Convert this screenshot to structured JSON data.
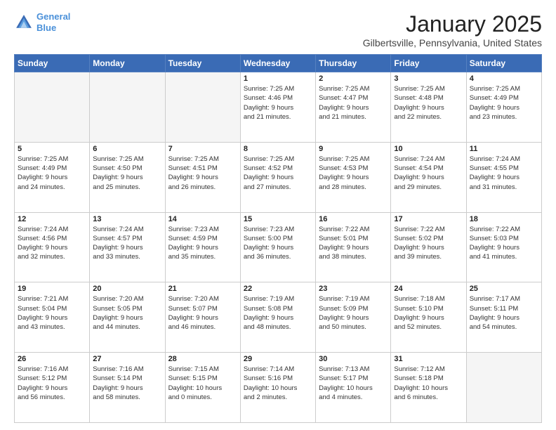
{
  "header": {
    "logo_line1": "General",
    "logo_line2": "Blue",
    "month": "January 2025",
    "location": "Gilbertsville, Pennsylvania, United States"
  },
  "weekdays": [
    "Sunday",
    "Monday",
    "Tuesday",
    "Wednesday",
    "Thursday",
    "Friday",
    "Saturday"
  ],
  "weeks": [
    [
      {
        "day": "",
        "info": ""
      },
      {
        "day": "",
        "info": ""
      },
      {
        "day": "",
        "info": ""
      },
      {
        "day": "1",
        "info": "Sunrise: 7:25 AM\nSunset: 4:46 PM\nDaylight: 9 hours\nand 21 minutes."
      },
      {
        "day": "2",
        "info": "Sunrise: 7:25 AM\nSunset: 4:47 PM\nDaylight: 9 hours\nand 21 minutes."
      },
      {
        "day": "3",
        "info": "Sunrise: 7:25 AM\nSunset: 4:48 PM\nDaylight: 9 hours\nand 22 minutes."
      },
      {
        "day": "4",
        "info": "Sunrise: 7:25 AM\nSunset: 4:49 PM\nDaylight: 9 hours\nand 23 minutes."
      }
    ],
    [
      {
        "day": "5",
        "info": "Sunrise: 7:25 AM\nSunset: 4:49 PM\nDaylight: 9 hours\nand 24 minutes."
      },
      {
        "day": "6",
        "info": "Sunrise: 7:25 AM\nSunset: 4:50 PM\nDaylight: 9 hours\nand 25 minutes."
      },
      {
        "day": "7",
        "info": "Sunrise: 7:25 AM\nSunset: 4:51 PM\nDaylight: 9 hours\nand 26 minutes."
      },
      {
        "day": "8",
        "info": "Sunrise: 7:25 AM\nSunset: 4:52 PM\nDaylight: 9 hours\nand 27 minutes."
      },
      {
        "day": "9",
        "info": "Sunrise: 7:25 AM\nSunset: 4:53 PM\nDaylight: 9 hours\nand 28 minutes."
      },
      {
        "day": "10",
        "info": "Sunrise: 7:24 AM\nSunset: 4:54 PM\nDaylight: 9 hours\nand 29 minutes."
      },
      {
        "day": "11",
        "info": "Sunrise: 7:24 AM\nSunset: 4:55 PM\nDaylight: 9 hours\nand 31 minutes."
      }
    ],
    [
      {
        "day": "12",
        "info": "Sunrise: 7:24 AM\nSunset: 4:56 PM\nDaylight: 9 hours\nand 32 minutes."
      },
      {
        "day": "13",
        "info": "Sunrise: 7:24 AM\nSunset: 4:57 PM\nDaylight: 9 hours\nand 33 minutes."
      },
      {
        "day": "14",
        "info": "Sunrise: 7:23 AM\nSunset: 4:59 PM\nDaylight: 9 hours\nand 35 minutes."
      },
      {
        "day": "15",
        "info": "Sunrise: 7:23 AM\nSunset: 5:00 PM\nDaylight: 9 hours\nand 36 minutes."
      },
      {
        "day": "16",
        "info": "Sunrise: 7:22 AM\nSunset: 5:01 PM\nDaylight: 9 hours\nand 38 minutes."
      },
      {
        "day": "17",
        "info": "Sunrise: 7:22 AM\nSunset: 5:02 PM\nDaylight: 9 hours\nand 39 minutes."
      },
      {
        "day": "18",
        "info": "Sunrise: 7:22 AM\nSunset: 5:03 PM\nDaylight: 9 hours\nand 41 minutes."
      }
    ],
    [
      {
        "day": "19",
        "info": "Sunrise: 7:21 AM\nSunset: 5:04 PM\nDaylight: 9 hours\nand 43 minutes."
      },
      {
        "day": "20",
        "info": "Sunrise: 7:20 AM\nSunset: 5:05 PM\nDaylight: 9 hours\nand 44 minutes."
      },
      {
        "day": "21",
        "info": "Sunrise: 7:20 AM\nSunset: 5:07 PM\nDaylight: 9 hours\nand 46 minutes."
      },
      {
        "day": "22",
        "info": "Sunrise: 7:19 AM\nSunset: 5:08 PM\nDaylight: 9 hours\nand 48 minutes."
      },
      {
        "day": "23",
        "info": "Sunrise: 7:19 AM\nSunset: 5:09 PM\nDaylight: 9 hours\nand 50 minutes."
      },
      {
        "day": "24",
        "info": "Sunrise: 7:18 AM\nSunset: 5:10 PM\nDaylight: 9 hours\nand 52 minutes."
      },
      {
        "day": "25",
        "info": "Sunrise: 7:17 AM\nSunset: 5:11 PM\nDaylight: 9 hours\nand 54 minutes."
      }
    ],
    [
      {
        "day": "26",
        "info": "Sunrise: 7:16 AM\nSunset: 5:12 PM\nDaylight: 9 hours\nand 56 minutes."
      },
      {
        "day": "27",
        "info": "Sunrise: 7:16 AM\nSunset: 5:14 PM\nDaylight: 9 hours\nand 58 minutes."
      },
      {
        "day": "28",
        "info": "Sunrise: 7:15 AM\nSunset: 5:15 PM\nDaylight: 10 hours\nand 0 minutes."
      },
      {
        "day": "29",
        "info": "Sunrise: 7:14 AM\nSunset: 5:16 PM\nDaylight: 10 hours\nand 2 minutes."
      },
      {
        "day": "30",
        "info": "Sunrise: 7:13 AM\nSunset: 5:17 PM\nDaylight: 10 hours\nand 4 minutes."
      },
      {
        "day": "31",
        "info": "Sunrise: 7:12 AM\nSunset: 5:18 PM\nDaylight: 10 hours\nand 6 minutes."
      },
      {
        "day": "",
        "info": ""
      }
    ]
  ]
}
